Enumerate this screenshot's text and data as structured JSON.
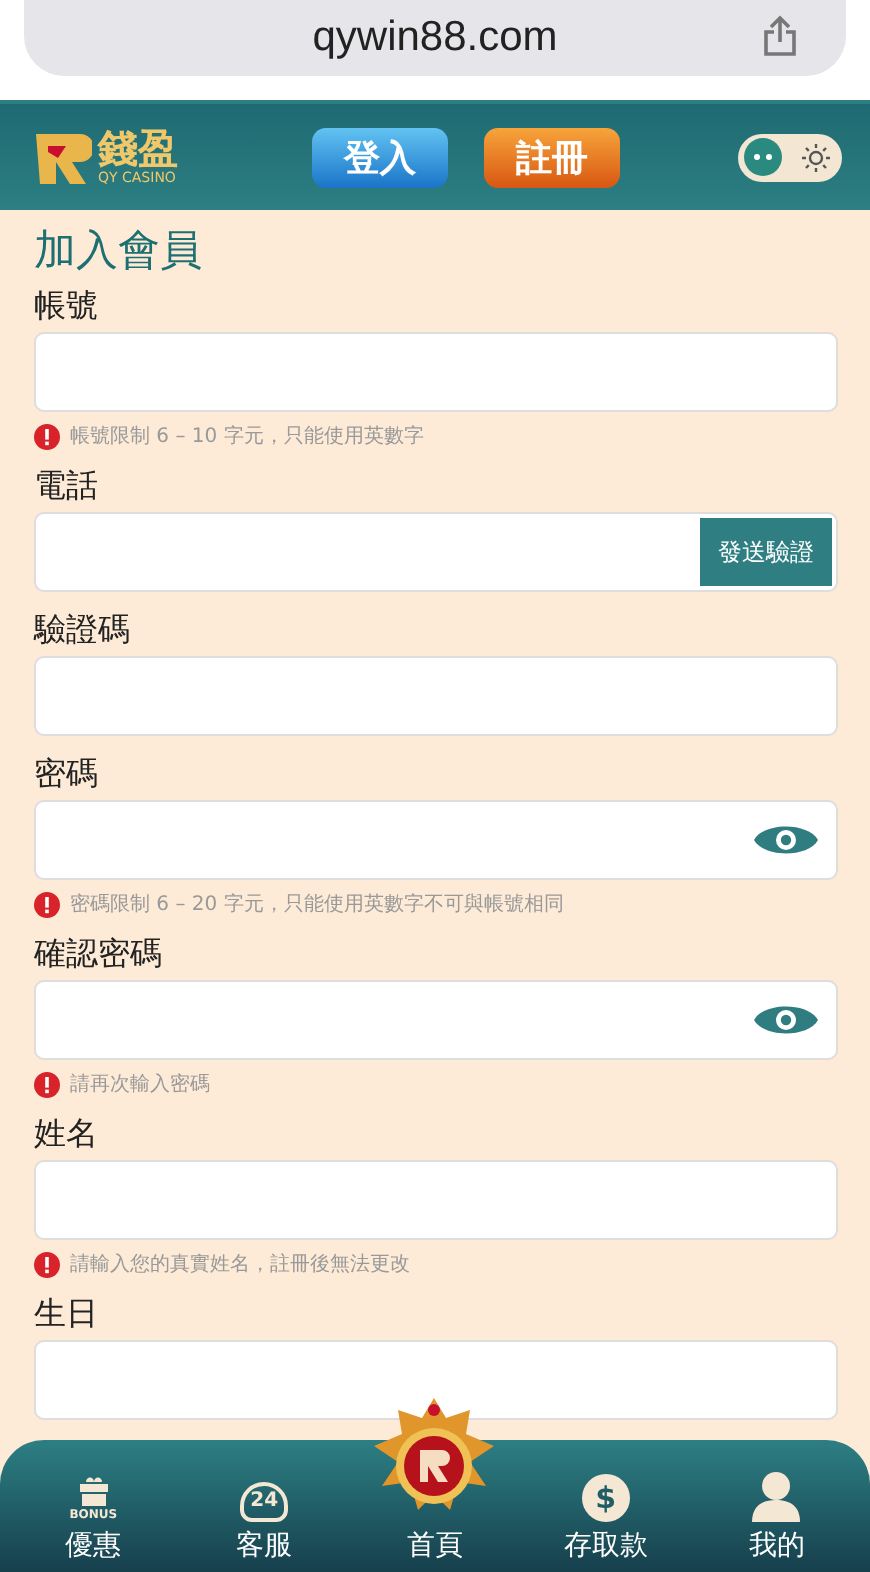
{
  "browser": {
    "url": "qywin88.com"
  },
  "header": {
    "logo_name": "錢盈",
    "logo_sub": "QY CASINO",
    "login": "登入",
    "register": "註冊",
    "theme_toggle": {
      "on": false
    }
  },
  "form": {
    "title": "加入會員",
    "fields": [
      {
        "label": "帳號",
        "kind": "text",
        "hint": "帳號限制 6 – 10 字元，只能使用英數字"
      },
      {
        "label": "電話",
        "kind": "send",
        "button": "發送驗證"
      },
      {
        "label": "驗證碼",
        "kind": "text"
      },
      {
        "label": "密碼",
        "kind": "password",
        "hint": "密碼限制 6 – 20 字元，只能使用英數字不可與帳號相同"
      },
      {
        "label": "確認密碼",
        "kind": "password",
        "hint": "請再次輸入密碼"
      },
      {
        "label": "姓名",
        "kind": "text",
        "hint": "請輸入您的真實姓名，註冊後無法更改"
      },
      {
        "label": "生日",
        "kind": "text"
      }
    ]
  },
  "nav": [
    {
      "label": "優惠",
      "kind": "bonus",
      "icon_text": "BONUS"
    },
    {
      "label": "客服",
      "kind": "service",
      "icon_text": "24"
    },
    {
      "label": "首頁",
      "kind": "home"
    },
    {
      "label": "存取款",
      "kind": "wallet",
      "icon_text": "$"
    },
    {
      "label": "我的",
      "kind": "profile"
    }
  ]
}
